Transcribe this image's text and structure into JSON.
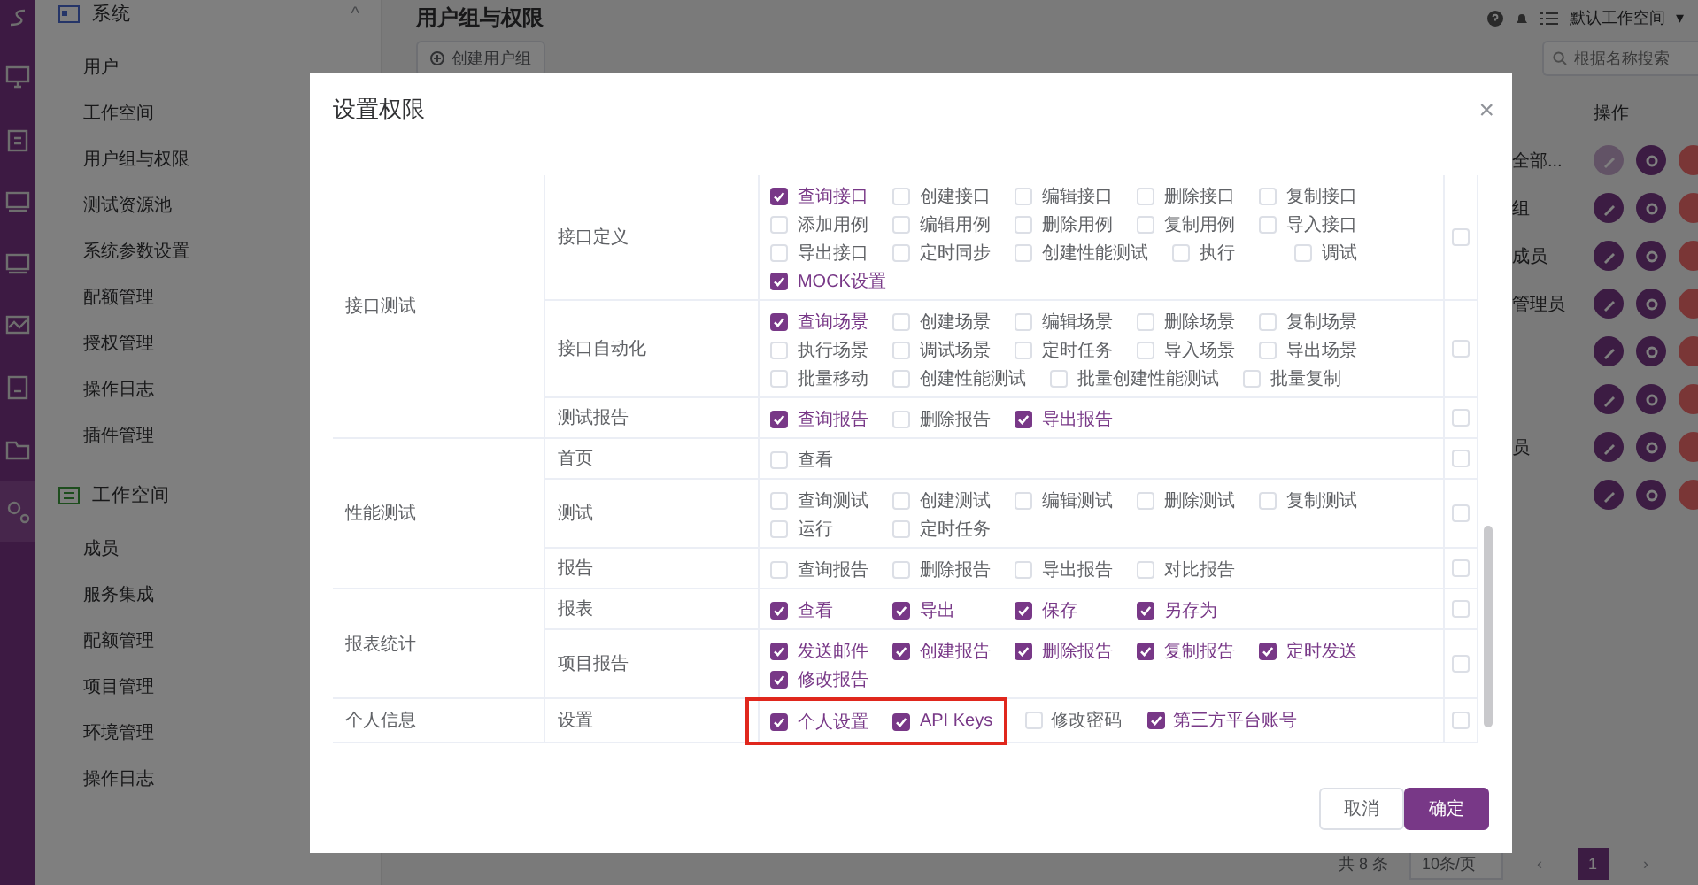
{
  "sidebar": {
    "sections": [
      {
        "title": "系统",
        "chevron": "^",
        "items": [
          "用户",
          "工作空间",
          "用户组与权限",
          "测试资源池",
          "系统参数设置",
          "配额管理",
          "授权管理",
          "操作日志",
          "插件管理"
        ]
      },
      {
        "title": "工作空间",
        "items": [
          "成员",
          "服务集成",
          "配额管理",
          "项目管理",
          "环境管理",
          "操作日志"
        ]
      }
    ]
  },
  "header": {
    "title": "用户组与权限",
    "create_button": "创建用户组",
    "workspace": "默认工作空间",
    "workspace_caret": "▾",
    "search": {
      "placeholder": "根据名称搜索"
    }
  },
  "table": {
    "action_column": "操作",
    "rows": [
      {
        "name": "全部...",
        "edit_disabled": true
      },
      {
        "name": "组",
        "edit_disabled": false
      },
      {
        "name": "成员",
        "edit_disabled": false
      },
      {
        "name": "管理员",
        "edit_disabled": false
      },
      {
        "edit_disabled": false
      },
      {
        "edit_disabled": false
      },
      {
        "name": "员",
        "edit_disabled": false
      },
      {
        "edit_disabled": false
      }
    ]
  },
  "pagination": {
    "total": "共 8 条",
    "page_size": "10条/页",
    "prev": "‹",
    "pages": [
      {
        "label": "1",
        "selected": true
      }
    ],
    "next": "›"
  },
  "modal": {
    "title": "设置权限",
    "close": "×",
    "groups": [
      {
        "name": "接口测试",
        "subs": [
          {
            "name": "接口定义",
            "all_checked": false,
            "perms": [
              {
                "label": "查询接口",
                "checked": true
              },
              {
                "label": "创建接口",
                "checked": false
              },
              {
                "label": "编辑接口",
                "checked": false
              },
              {
                "label": "删除接口",
                "checked": false
              },
              {
                "label": "复制接口",
                "checked": false
              },
              {
                "label": "添加用例",
                "checked": false
              },
              {
                "label": "编辑用例",
                "checked": false
              },
              {
                "label": "删除用例",
                "checked": false
              },
              {
                "label": "复制用例",
                "checked": false
              },
              {
                "label": "导入接口",
                "checked": false
              },
              {
                "label": "导出接口",
                "checked": false
              },
              {
                "label": "定时同步",
                "checked": false
              },
              {
                "label": "创建性能测试",
                "checked": false
              },
              {
                "label": "执行",
                "checked": false
              },
              {
                "label": "调试",
                "checked": false
              },
              {
                "label": "MOCK设置",
                "checked": true
              }
            ]
          },
          {
            "name": "接口自动化",
            "all_checked": false,
            "perms": [
              {
                "label": "查询场景",
                "checked": true
              },
              {
                "label": "创建场景",
                "checked": false
              },
              {
                "label": "编辑场景",
                "checked": false
              },
              {
                "label": "删除场景",
                "checked": false
              },
              {
                "label": "复制场景",
                "checked": false
              },
              {
                "label": "执行场景",
                "checked": false
              },
              {
                "label": "调试场景",
                "checked": false
              },
              {
                "label": "定时任务",
                "checked": false
              },
              {
                "label": "导入场景",
                "checked": false
              },
              {
                "label": "导出场景",
                "checked": false
              },
              {
                "label": "批量移动",
                "checked": false
              },
              {
                "label": "创建性能测试",
                "checked": false
              },
              {
                "label": "批量创建性能测试",
                "checked": false
              },
              {
                "label": "批量复制",
                "checked": false
              }
            ]
          },
          {
            "name": "测试报告",
            "all_checked": false,
            "perms": [
              {
                "label": "查询报告",
                "checked": true
              },
              {
                "label": "删除报告",
                "checked": false
              },
              {
                "label": "导出报告",
                "checked": true
              }
            ]
          }
        ]
      },
      {
        "name": "性能测试",
        "subs": [
          {
            "name": "首页",
            "all_checked": false,
            "perms": [
              {
                "label": "查看",
                "checked": false
              }
            ]
          },
          {
            "name": "测试",
            "all_checked": false,
            "perms": [
              {
                "label": "查询测试",
                "checked": false
              },
              {
                "label": "创建测试",
                "checked": false
              },
              {
                "label": "编辑测试",
                "checked": false
              },
              {
                "label": "删除测试",
                "checked": false
              },
              {
                "label": "复制测试",
                "checked": false
              },
              {
                "label": "运行",
                "checked": false
              },
              {
                "label": "定时任务",
                "checked": false
              }
            ]
          },
          {
            "name": "报告",
            "all_checked": false,
            "perms": [
              {
                "label": "查询报告",
                "checked": false
              },
              {
                "label": "删除报告",
                "checked": false
              },
              {
                "label": "导出报告",
                "checked": false
              },
              {
                "label": "对比报告",
                "checked": false
              }
            ]
          }
        ]
      },
      {
        "name": "报表统计",
        "subs": [
          {
            "name": "报表",
            "all_checked": false,
            "perms": [
              {
                "label": "查看",
                "checked": true
              },
              {
                "label": "导出",
                "checked": true
              },
              {
                "label": "保存",
                "checked": true
              },
              {
                "label": "另存为",
                "checked": true
              }
            ]
          },
          {
            "name": "项目报告",
            "all_checked": false,
            "perms": [
              {
                "label": "发送邮件",
                "checked": true
              },
              {
                "label": "创建报告",
                "checked": true
              },
              {
                "label": "删除报告",
                "checked": true
              },
              {
                "label": "复制报告",
                "checked": true
              },
              {
                "label": "定时发送",
                "checked": true
              },
              {
                "label": "修改报告",
                "checked": true
              }
            ]
          }
        ]
      },
      {
        "name": "个人信息",
        "subs": [
          {
            "name": "设置",
            "all_checked": false,
            "perms": [
              {
                "label": "个人设置",
                "checked": true,
                "highlighted": true
              },
              {
                "label": "API Keys",
                "checked": true,
                "highlighted": true
              },
              {
                "label": "修改密码",
                "checked": false,
                "highlighted": false
              },
              {
                "label": "第三方平台账号",
                "checked": true,
                "highlighted": false
              }
            ]
          }
        ]
      }
    ],
    "buttons": [
      {
        "label": "取消",
        "kind": "cancel"
      },
      {
        "label": "确定",
        "kind": "primary"
      }
    ]
  }
}
